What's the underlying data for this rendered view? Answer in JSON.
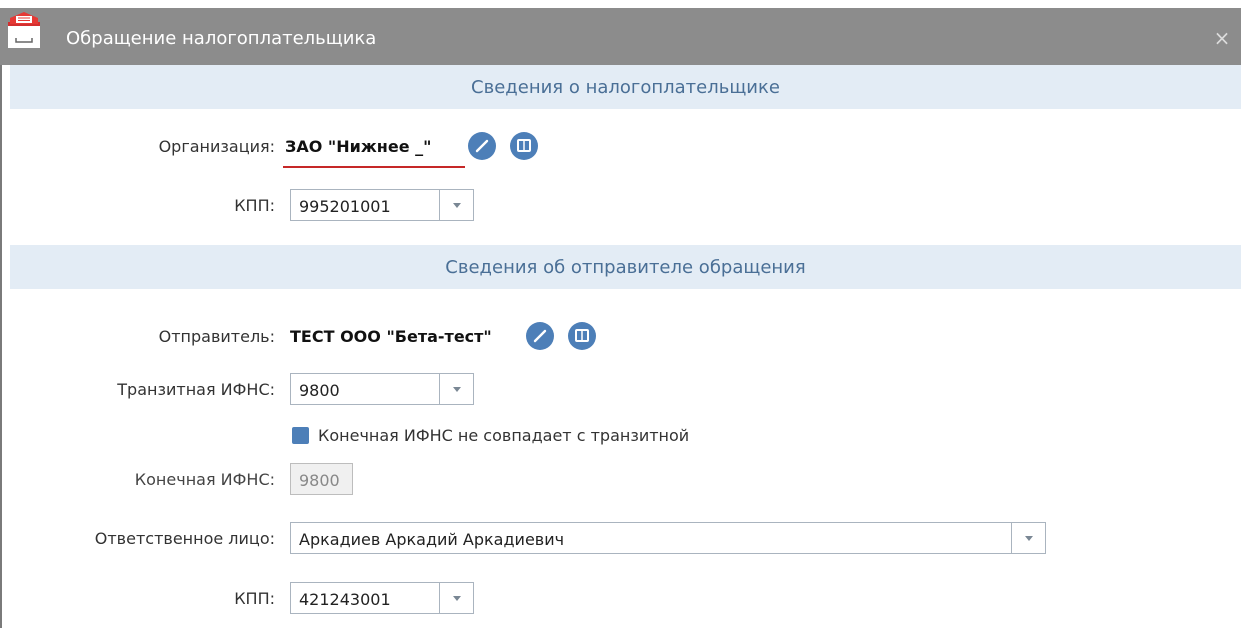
{
  "window": {
    "title": "Обращение налогоплательщика",
    "close_glyph": "×"
  },
  "section_taxpayer": {
    "header": "Сведения о налогоплательщике",
    "org_label": "Организация:",
    "org_value": "ЗАО \"Нижнее _\"",
    "kpp_label": "КПП:",
    "kpp_value": "995201001"
  },
  "section_sender": {
    "header": "Сведения об отправителе обращения",
    "sender_label": "Отправитель:",
    "sender_value": "ТЕСТ ООО \"Бета-тест\"",
    "transit_label": "Транзитная ИФНС:",
    "transit_value": "9800",
    "checkbox_label": "Конечная ИФНС не совпадает с транзитной",
    "checkbox_checked": true,
    "final_label": "Конечная ИФНС:",
    "final_value": "9800",
    "responsible_label": "Ответственное лицо:",
    "responsible_value": "Аркадиев Аркадий Аркадиевич",
    "kpp2_label": "КПП:",
    "kpp2_value": "421243001"
  },
  "icons": [
    "app-icon",
    "edit-icon",
    "card-icon",
    "chevron-down-icon",
    "close-icon"
  ],
  "colors": {
    "titlebar": "#8c8c8c",
    "section_bg": "#e3ecf5",
    "section_text": "#4a6f96",
    "accent": "#4d7fb8",
    "error_underline": "#c62828"
  }
}
